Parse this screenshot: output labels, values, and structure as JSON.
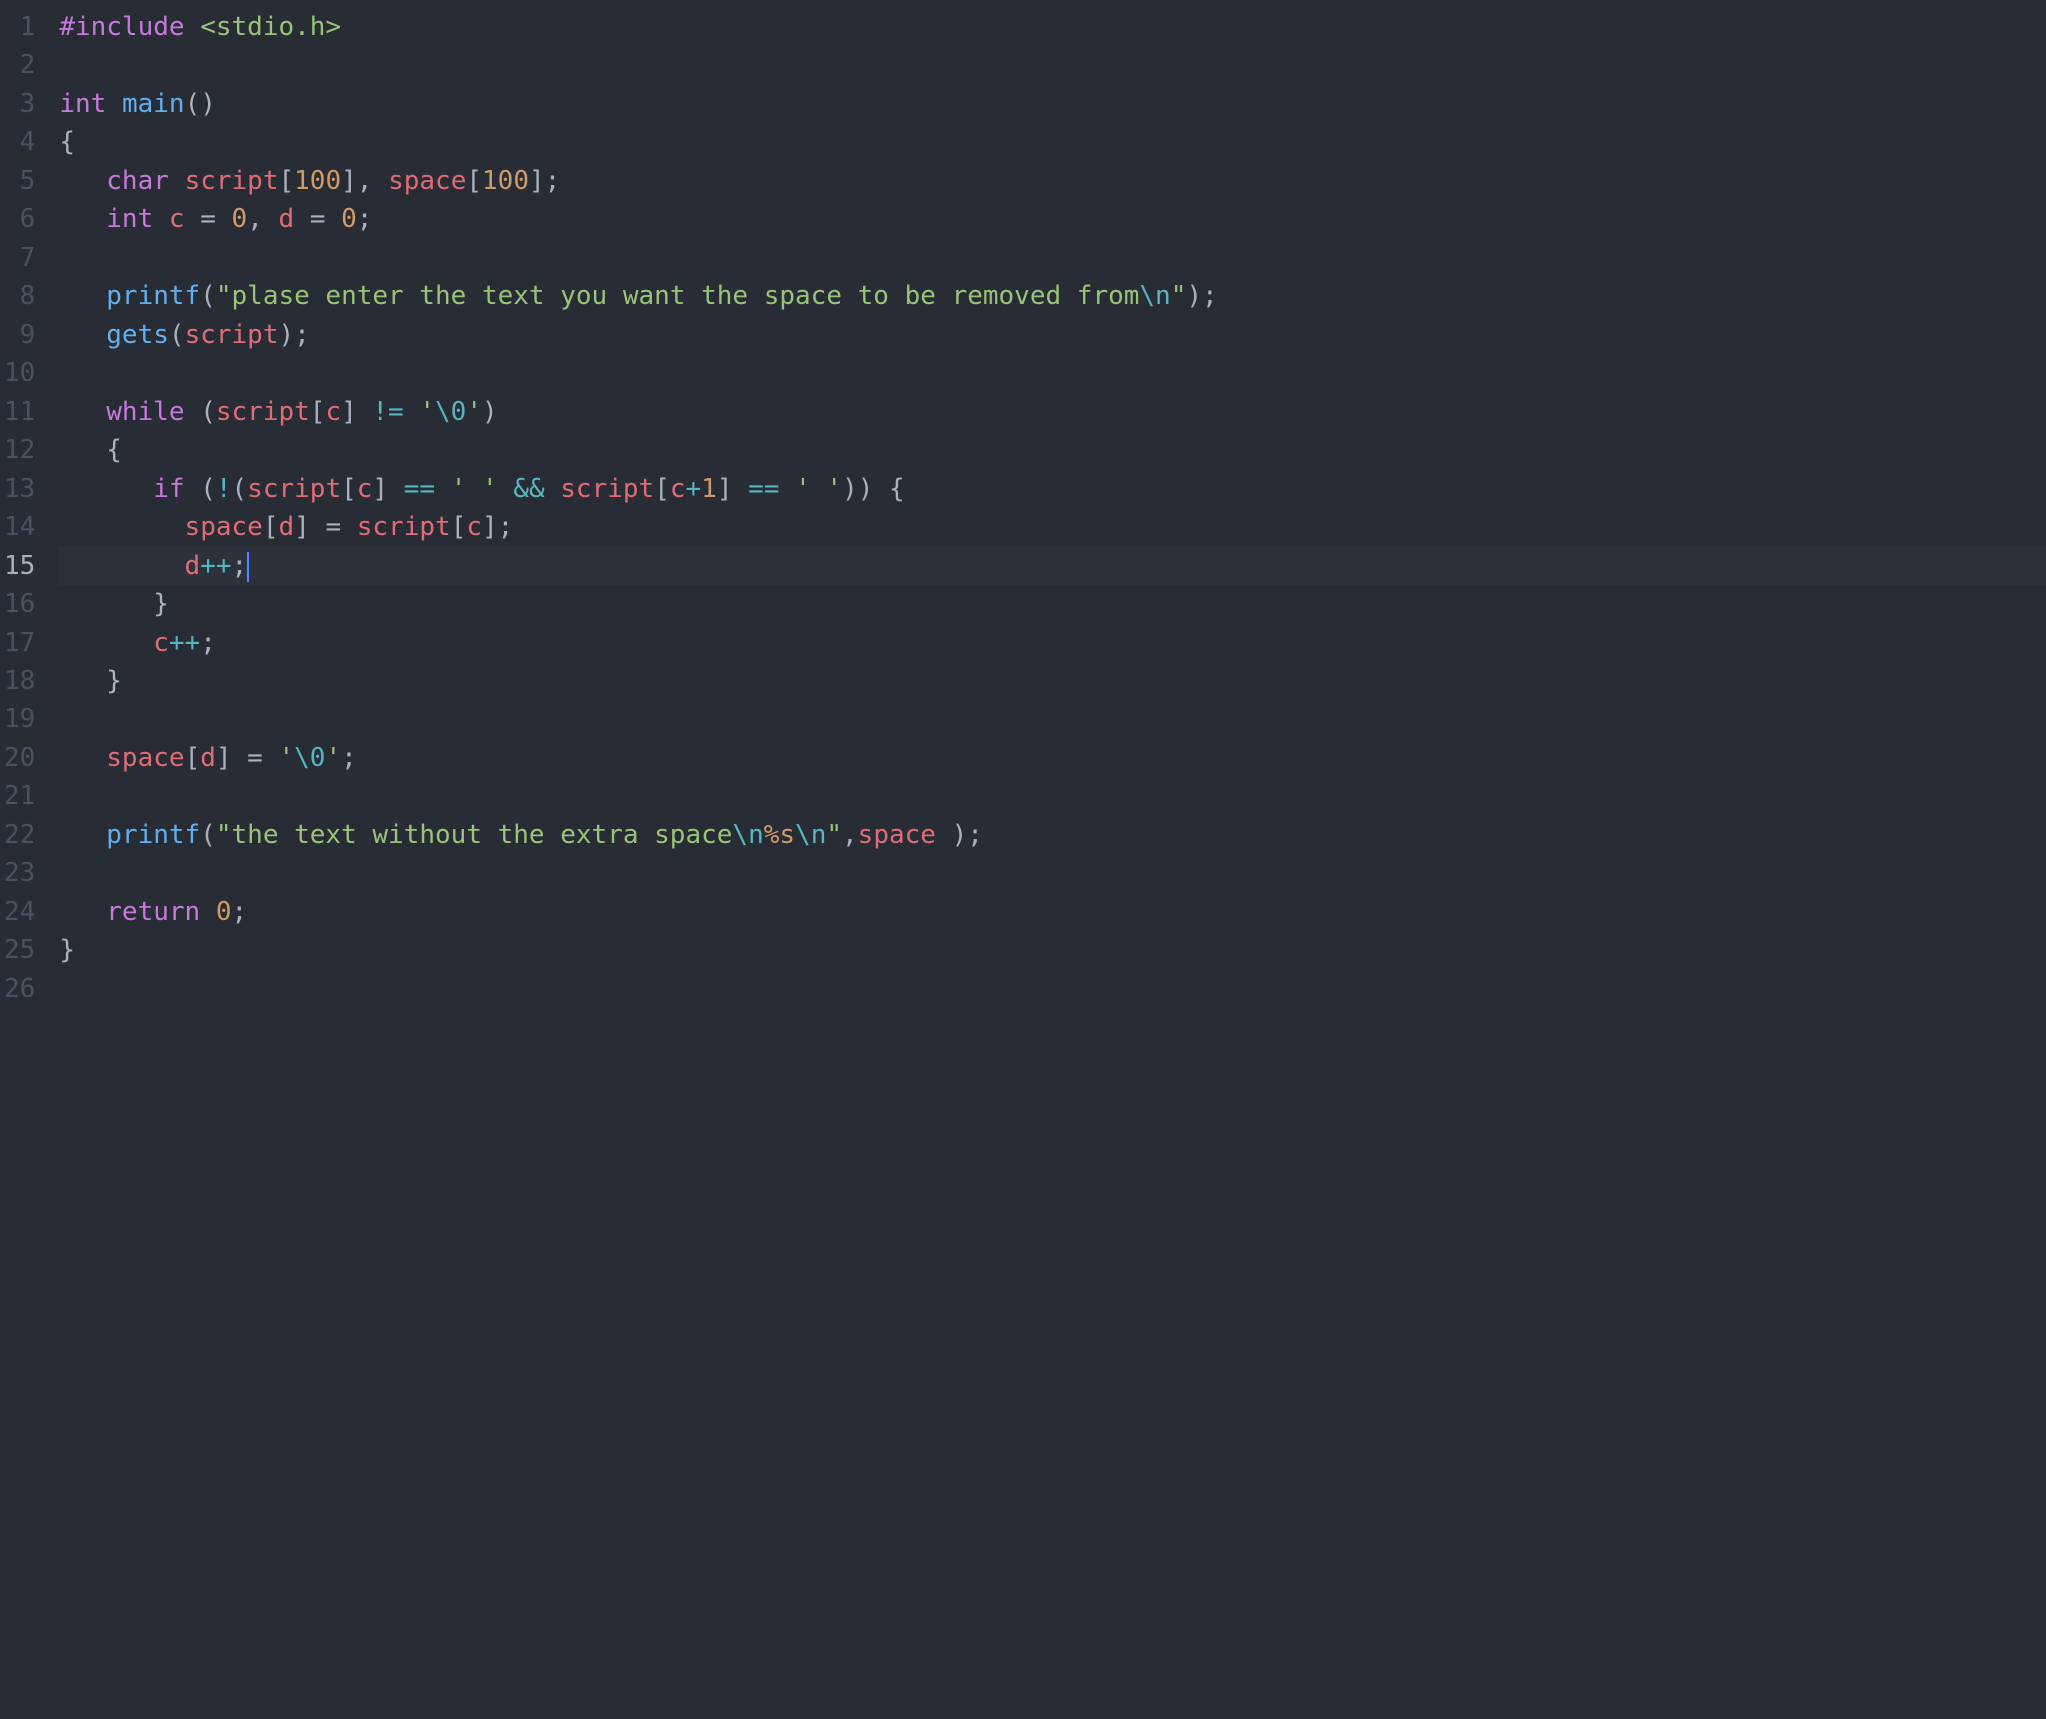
{
  "editor": {
    "active_line": 15,
    "gutter": [
      "1",
      "2",
      "3",
      "4",
      "5",
      "6",
      "7",
      "8",
      "9",
      "10",
      "11",
      "12",
      "13",
      "14",
      "15",
      "16",
      "17",
      "18",
      "19",
      "20",
      "21",
      "22",
      "23",
      "24",
      "25",
      "26"
    ],
    "lines": [
      {
        "indent": "",
        "tokens": [
          {
            "t": "#include ",
            "c": "tk-keyword"
          },
          {
            "t": "<stdio.h>",
            "c": "tk-include-h"
          }
        ]
      },
      {
        "indent": "",
        "tokens": []
      },
      {
        "indent": "",
        "tokens": [
          {
            "t": "int ",
            "c": "tk-type"
          },
          {
            "t": "main",
            "c": "tk-func"
          },
          {
            "t": "()",
            "c": "tk-punct"
          }
        ]
      },
      {
        "indent": "",
        "tokens": [
          {
            "t": "{",
            "c": "tk-punct"
          }
        ]
      },
      {
        "indent": "   ",
        "tokens": [
          {
            "t": "char ",
            "c": "tk-type"
          },
          {
            "t": "script",
            "c": "tk-ident"
          },
          {
            "t": "[",
            "c": "tk-punct"
          },
          {
            "t": "100",
            "c": "tk-number"
          },
          {
            "t": "], ",
            "c": "tk-punct"
          },
          {
            "t": "space",
            "c": "tk-ident"
          },
          {
            "t": "[",
            "c": "tk-punct"
          },
          {
            "t": "100",
            "c": "tk-number"
          },
          {
            "t": "];",
            "c": "tk-punct"
          }
        ]
      },
      {
        "indent": "   ",
        "tokens": [
          {
            "t": "int ",
            "c": "tk-type"
          },
          {
            "t": "c",
            "c": "tk-ident"
          },
          {
            "t": " = ",
            "c": "tk-punct"
          },
          {
            "t": "0",
            "c": "tk-number"
          },
          {
            "t": ", ",
            "c": "tk-punct"
          },
          {
            "t": "d",
            "c": "tk-ident"
          },
          {
            "t": " = ",
            "c": "tk-punct"
          },
          {
            "t": "0",
            "c": "tk-number"
          },
          {
            "t": ";",
            "c": "tk-punct"
          }
        ]
      },
      {
        "indent": "",
        "tokens": []
      },
      {
        "indent": "   ",
        "tokens": [
          {
            "t": "printf",
            "c": "tk-func"
          },
          {
            "t": "(",
            "c": "tk-punct"
          },
          {
            "t": "\"plase enter the text you want the space to be removed from",
            "c": "tk-string"
          },
          {
            "t": "\\n",
            "c": "tk-escape"
          },
          {
            "t": "\"",
            "c": "tk-string"
          },
          {
            "t": ");",
            "c": "tk-punct"
          }
        ]
      },
      {
        "indent": "   ",
        "tokens": [
          {
            "t": "gets",
            "c": "tk-func"
          },
          {
            "t": "(",
            "c": "tk-punct"
          },
          {
            "t": "script",
            "c": "tk-ident"
          },
          {
            "t": ");",
            "c": "tk-punct"
          }
        ]
      },
      {
        "indent": "",
        "tokens": []
      },
      {
        "indent": "   ",
        "tokens": [
          {
            "t": "while ",
            "c": "tk-keyword"
          },
          {
            "t": "(",
            "c": "tk-punct"
          },
          {
            "t": "script",
            "c": "tk-ident"
          },
          {
            "t": "[",
            "c": "tk-punct"
          },
          {
            "t": "c",
            "c": "tk-ident"
          },
          {
            "t": "] ",
            "c": "tk-punct"
          },
          {
            "t": "!=",
            "c": "tk-op"
          },
          {
            "t": " ",
            "c": "tk-punct"
          },
          {
            "t": "'",
            "c": "tk-string"
          },
          {
            "t": "\\0",
            "c": "tk-escape"
          },
          {
            "t": "'",
            "c": "tk-string"
          },
          {
            "t": ")",
            "c": "tk-punct"
          }
        ]
      },
      {
        "indent": "   ",
        "tokens": [
          {
            "t": "{",
            "c": "tk-punct"
          }
        ]
      },
      {
        "indent": "      ",
        "tokens": [
          {
            "t": "if ",
            "c": "tk-keyword"
          },
          {
            "t": "(",
            "c": "tk-punct"
          },
          {
            "t": "!",
            "c": "tk-op"
          },
          {
            "t": "(",
            "c": "tk-punct"
          },
          {
            "t": "script",
            "c": "tk-ident"
          },
          {
            "t": "[",
            "c": "tk-punct"
          },
          {
            "t": "c",
            "c": "tk-ident"
          },
          {
            "t": "] ",
            "c": "tk-punct"
          },
          {
            "t": "==",
            "c": "tk-op"
          },
          {
            "t": " ",
            "c": "tk-punct"
          },
          {
            "t": "' '",
            "c": "tk-string"
          },
          {
            "t": " ",
            "c": "tk-punct"
          },
          {
            "t": "&&",
            "c": "tk-op"
          },
          {
            "t": " ",
            "c": "tk-punct"
          },
          {
            "t": "script",
            "c": "tk-ident"
          },
          {
            "t": "[",
            "c": "tk-punct"
          },
          {
            "t": "c",
            "c": "tk-ident"
          },
          {
            "t": "+",
            "c": "tk-op"
          },
          {
            "t": "1",
            "c": "tk-number"
          },
          {
            "t": "] ",
            "c": "tk-punct"
          },
          {
            "t": "==",
            "c": "tk-op"
          },
          {
            "t": " ",
            "c": "tk-punct"
          },
          {
            "t": "' '",
            "c": "tk-string"
          },
          {
            "t": ")) {",
            "c": "tk-punct"
          }
        ]
      },
      {
        "indent": "        ",
        "tokens": [
          {
            "t": "space",
            "c": "tk-ident"
          },
          {
            "t": "[",
            "c": "tk-punct"
          },
          {
            "t": "d",
            "c": "tk-ident"
          },
          {
            "t": "] = ",
            "c": "tk-punct"
          },
          {
            "t": "script",
            "c": "tk-ident"
          },
          {
            "t": "[",
            "c": "tk-punct"
          },
          {
            "t": "c",
            "c": "tk-ident"
          },
          {
            "t": "];",
            "c": "tk-punct"
          }
        ]
      },
      {
        "indent": "        ",
        "tokens": [
          {
            "t": "d",
            "c": "tk-ident"
          },
          {
            "t": "++",
            "c": "tk-op"
          },
          {
            "t": ";",
            "c": "tk-punct"
          }
        ],
        "cursor_after": true
      },
      {
        "indent": "      ",
        "tokens": [
          {
            "t": "}",
            "c": "tk-punct"
          }
        ]
      },
      {
        "indent": "      ",
        "tokens": [
          {
            "t": "c",
            "c": "tk-ident"
          },
          {
            "t": "++",
            "c": "tk-op"
          },
          {
            "t": ";",
            "c": "tk-punct"
          }
        ]
      },
      {
        "indent": "   ",
        "tokens": [
          {
            "t": "}",
            "c": "tk-punct"
          }
        ]
      },
      {
        "indent": "",
        "tokens": []
      },
      {
        "indent": "   ",
        "tokens": [
          {
            "t": "space",
            "c": "tk-ident"
          },
          {
            "t": "[",
            "c": "tk-punct"
          },
          {
            "t": "d",
            "c": "tk-ident"
          },
          {
            "t": "] = ",
            "c": "tk-punct"
          },
          {
            "t": "'",
            "c": "tk-string"
          },
          {
            "t": "\\0",
            "c": "tk-escape"
          },
          {
            "t": "'",
            "c": "tk-string"
          },
          {
            "t": ";",
            "c": "tk-punct"
          }
        ]
      },
      {
        "indent": "",
        "tokens": []
      },
      {
        "indent": "   ",
        "tokens": [
          {
            "t": "printf",
            "c": "tk-func"
          },
          {
            "t": "(",
            "c": "tk-punct"
          },
          {
            "t": "\"the text without the extra space",
            "c": "tk-string"
          },
          {
            "t": "\\n",
            "c": "tk-escape"
          },
          {
            "t": "%s",
            "c": "tk-number"
          },
          {
            "t": "\\n",
            "c": "tk-escape"
          },
          {
            "t": "\"",
            "c": "tk-string"
          },
          {
            "t": ",",
            "c": "tk-punct"
          },
          {
            "t": "space ",
            "c": "tk-ident"
          },
          {
            "t": ");",
            "c": "tk-punct"
          }
        ]
      },
      {
        "indent": "",
        "tokens": []
      },
      {
        "indent": "   ",
        "tokens": [
          {
            "t": "return ",
            "c": "tk-keyword"
          },
          {
            "t": "0",
            "c": "tk-number"
          },
          {
            "t": ";",
            "c": "tk-punct"
          }
        ]
      },
      {
        "indent": "",
        "tokens": [
          {
            "t": "}",
            "c": "tk-punct"
          }
        ]
      },
      {
        "indent": "",
        "tokens": []
      }
    ]
  }
}
